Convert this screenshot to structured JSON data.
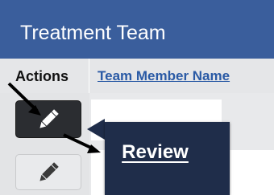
{
  "panel": {
    "title": "Treatment Team"
  },
  "table": {
    "columns": [
      "Actions",
      "Team Member Name"
    ]
  },
  "tooltip": {
    "label": "Review"
  },
  "icons": {
    "edit": "pencil-icon",
    "annotation": "arrow-icon"
  },
  "colors": {
    "title_bar": "#3a5e9c",
    "header_link": "#2a5aa5",
    "tooltip_bg": "#1f2d4a",
    "active_button": "#2b2d31"
  }
}
